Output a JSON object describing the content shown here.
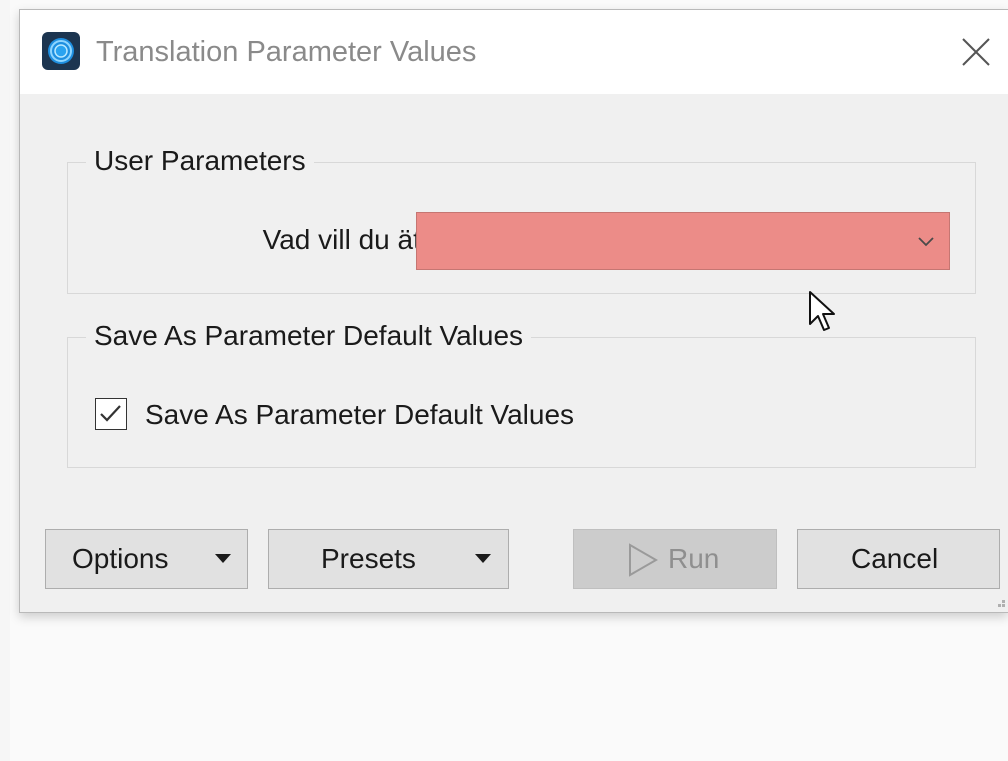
{
  "window": {
    "title": "Translation Parameter Values",
    "icon": "app-logo-icon",
    "close_icon": "close-icon"
  },
  "user_parameters": {
    "group_title": "User Parameters",
    "fields": [
      {
        "label": "Vad vill du äta?",
        "value": "",
        "control": "dropdown",
        "state": "invalid",
        "highlight_color": "#ec8c88"
      }
    ]
  },
  "save_defaults": {
    "group_title": "Save As Parameter Default Values",
    "checkbox_label": "Save As Parameter Default Values",
    "checked": true
  },
  "buttons": {
    "options": "Options",
    "presets": "Presets",
    "run": "Run",
    "run_enabled": false,
    "cancel": "Cancel"
  }
}
